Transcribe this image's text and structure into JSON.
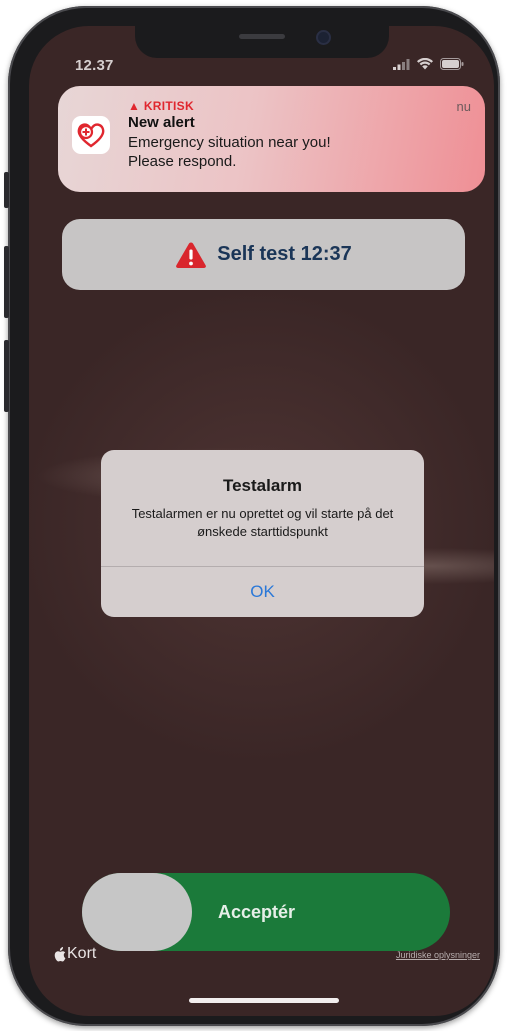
{
  "status_bar": {
    "time": "12.37",
    "icons": [
      "signal-icon",
      "wifi-icon",
      "battery-icon"
    ]
  },
  "notification": {
    "critical_label": "KRITISK",
    "title": "New alert",
    "body_line1": "Emergency situation near you!",
    "body_line2": "Please respond.",
    "time": "nu",
    "app_icon": "heart-cross-icon",
    "accent_color": "#e0272f"
  },
  "self_test_banner": {
    "label": "Self test 12:37",
    "icon": "warning-triangle-icon"
  },
  "dialog": {
    "title": "Testalarm",
    "message": "Testalarmen er nu oprettet og vil starte på det ønskede starttidspunkt",
    "ok_label": "OK"
  },
  "accept_slider": {
    "label": "Acceptér",
    "color": "#1b7a3a"
  },
  "map_footer": {
    "maps_label": "Kort",
    "legal_link": "Juridiske oplysninger"
  }
}
